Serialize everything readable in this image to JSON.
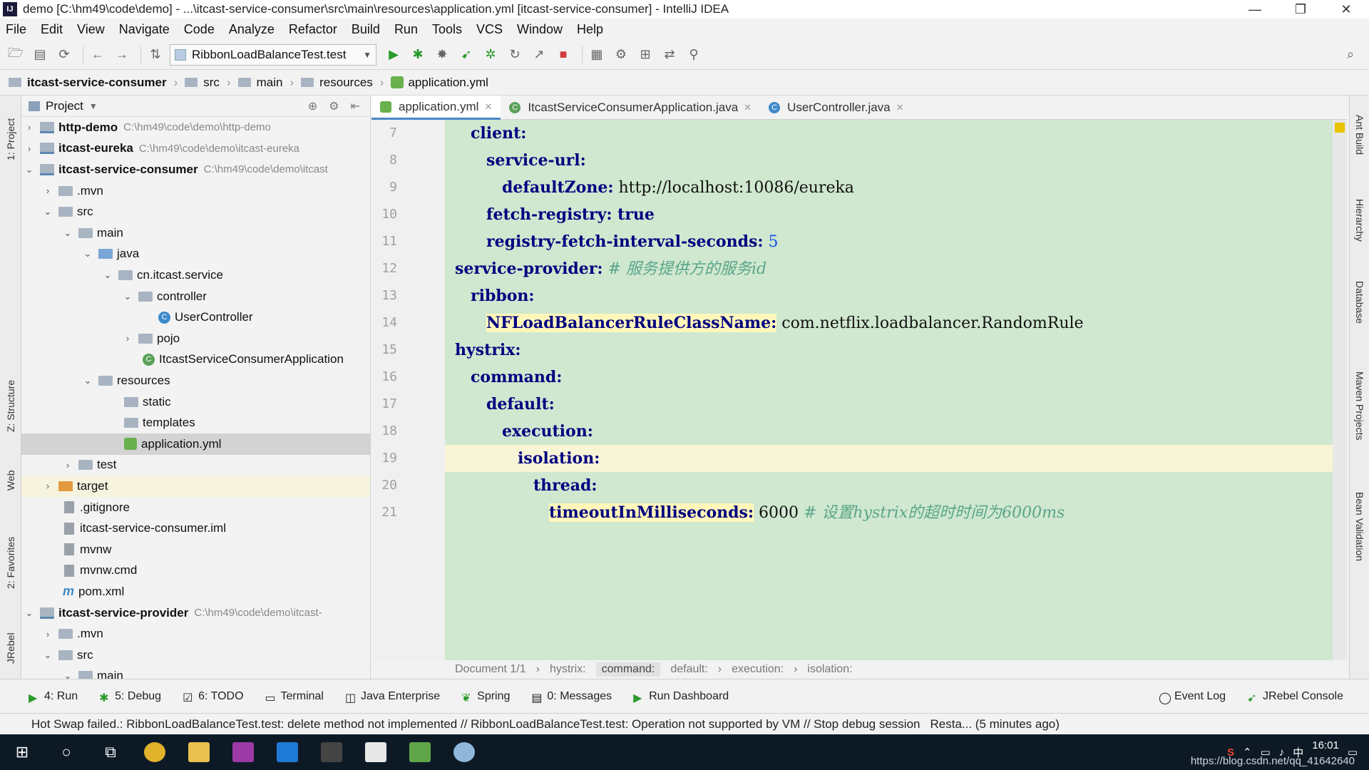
{
  "window": {
    "title": "demo [C:\\hm49\\code\\demo] - ...\\itcast-service-consumer\\src\\main\\resources\\application.yml [itcast-service-consumer] - IntelliJ IDEA",
    "minimize": "—",
    "restore": "❐",
    "close": "✕"
  },
  "menu": [
    "File",
    "Edit",
    "View",
    "Navigate",
    "Code",
    "Analyze",
    "Refactor",
    "Build",
    "Run",
    "Tools",
    "VCS",
    "Window",
    "Help"
  ],
  "toolbar": {
    "run_config": "RibbonLoadBalanceTest.test"
  },
  "navbar": {
    "crumbs": [
      "itcast-service-consumer",
      "src",
      "main",
      "resources",
      "application.yml"
    ]
  },
  "project_panel": {
    "title": "Project",
    "tree": [
      {
        "label": "http-demo",
        "path": "C:\\hm49\\code\\demo\\http-demo"
      },
      {
        "label": "itcast-eureka",
        "path": "C:\\hm49\\code\\demo\\itcast-eureka"
      },
      {
        "label": "itcast-service-consumer",
        "path": "C:\\hm49\\code\\demo\\itcast"
      },
      {
        "label": ".mvn"
      },
      {
        "label": "src"
      },
      {
        "label": "main"
      },
      {
        "label": "java"
      },
      {
        "label": "cn.itcast.service"
      },
      {
        "label": "controller"
      },
      {
        "label": "UserController"
      },
      {
        "label": "pojo"
      },
      {
        "label": "ItcastServiceConsumerApplication"
      },
      {
        "label": "resources"
      },
      {
        "label": "static"
      },
      {
        "label": "templates"
      },
      {
        "label": "application.yml"
      },
      {
        "label": "test"
      },
      {
        "label": "target"
      },
      {
        "label": ".gitignore"
      },
      {
        "label": "itcast-service-consumer.iml"
      },
      {
        "label": "mvnw"
      },
      {
        "label": "mvnw.cmd"
      },
      {
        "label": "pom.xml"
      },
      {
        "label": "itcast-service-provider",
        "path": "C:\\hm49\\code\\demo\\itcast-"
      },
      {
        "label": ".mvn"
      },
      {
        "label": "src"
      },
      {
        "label": "main"
      }
    ]
  },
  "left_tool_tabs": [
    "1: Project",
    "Z: Structure",
    "Web",
    "2: Favorites",
    "JRebel"
  ],
  "right_tool_tabs": [
    "Ant Build",
    "Hierarchy",
    "Database",
    "Maven Projects",
    "Bean Validation"
  ],
  "editor": {
    "tabs": [
      "application.yml",
      "ItcastServiceConsumerApplication.java",
      "UserController.java"
    ],
    "lines": [
      {
        "no": "7",
        "key": "client:",
        "value": "",
        "comment": ""
      },
      {
        "no": "8",
        "key": "service-url:",
        "value": "",
        "comment": ""
      },
      {
        "no": "9",
        "key": "defaultZone:",
        "value": " http://localhost:10086/eureka",
        "comment": ""
      },
      {
        "no": "10",
        "key": "fetch-registry:",
        "value": " true",
        "comment": ""
      },
      {
        "no": "11",
        "key": "registry-fetch-interval-seconds:",
        "value": " 5",
        "comment": ""
      },
      {
        "no": "12",
        "key": "service-provider:",
        "value": "",
        "comment": " # 服务提供方的服务id"
      },
      {
        "no": "13",
        "key": "ribbon:",
        "value": "",
        "comment": ""
      },
      {
        "no": "14",
        "key": "NFLoadBalancerRuleClassName:",
        "value": " com.netflix.loadbalancer.RandomRule",
        "comment": ""
      },
      {
        "no": "15",
        "key": "hystrix:",
        "value": "",
        "comment": ""
      },
      {
        "no": "16",
        "key": "command:",
        "value": "",
        "comment": ""
      },
      {
        "no": "17",
        "key": "default:",
        "value": "",
        "comment": ""
      },
      {
        "no": "18",
        "key": "execution:",
        "value": "",
        "comment": ""
      },
      {
        "no": "19",
        "key": "isolation:",
        "value": "",
        "comment": ""
      },
      {
        "no": "20",
        "key": "thread:",
        "value": "",
        "comment": ""
      },
      {
        "no": "21",
        "key": "timeoutInMilliseconds:",
        "value": " 6000",
        "comment": " # 设置hystrix的超时时间为6000ms"
      }
    ],
    "breadcrumbs": [
      "Document 1/1",
      "hystrix:",
      "command:",
      "default:",
      "execution:",
      "isolation:"
    ]
  },
  "bottom_tabs": [
    "4: Run",
    "5: Debug",
    "6: TODO",
    "Terminal",
    "Java Enterprise",
    "Spring",
    "0: Messages",
    "Run Dashboard",
    "Event Log",
    "JRebel Console"
  ],
  "status": {
    "message": "Hot Swap failed.: RibbonLoadBalanceTest.test: delete method not implemented // RibbonLoadBalanceTest.test: Operation not supported by VM // Stop debug session",
    "restart": "Resta... (5 minutes ago)"
  },
  "taskbar": {
    "time": "16:01",
    "ime": "中",
    "watermark": "https://blog.csdn.net/qq_41642640"
  },
  "colors": {
    "editor_bg": "#cfe8cf",
    "current_line": "#f8f4d6",
    "key": "#000080",
    "comment": "#5aa58a"
  }
}
